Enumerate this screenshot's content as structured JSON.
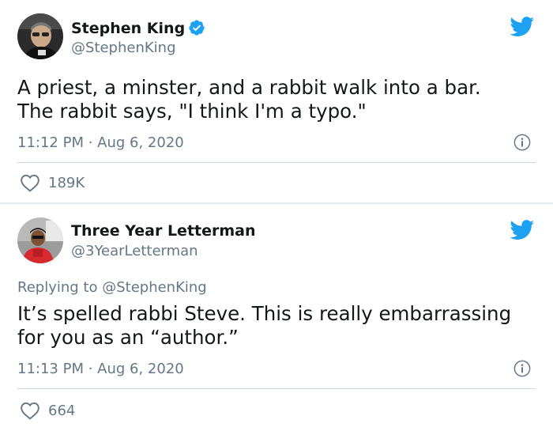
{
  "tweets": [
    {
      "name": "Stephen King",
      "handle": "@StephenKing",
      "verified": true,
      "replying_to": "",
      "text": "A priest, a minster, and a rabbit walk into a bar. The rabbit says, \"I think I'm a typo.\"",
      "time": "11:12 PM",
      "date": "Aug 6, 2020",
      "likes": "189K"
    },
    {
      "name": "Three Year Letterman",
      "handle": "@3YearLetterman",
      "verified": false,
      "replying_to_prefix": "Replying to",
      "replying_to": "@StephenKing",
      "text": "It’s spelled rabbi Steve. This is really embarrassing for you as an “author.”",
      "time": "11:13 PM",
      "date": "Aug 6, 2020",
      "likes": "664"
    }
  ],
  "colors": {
    "twitter_blue": "#1da1f2",
    "text": "#14171a",
    "secondary": "#657786",
    "divider": "#ccd6dd"
  }
}
